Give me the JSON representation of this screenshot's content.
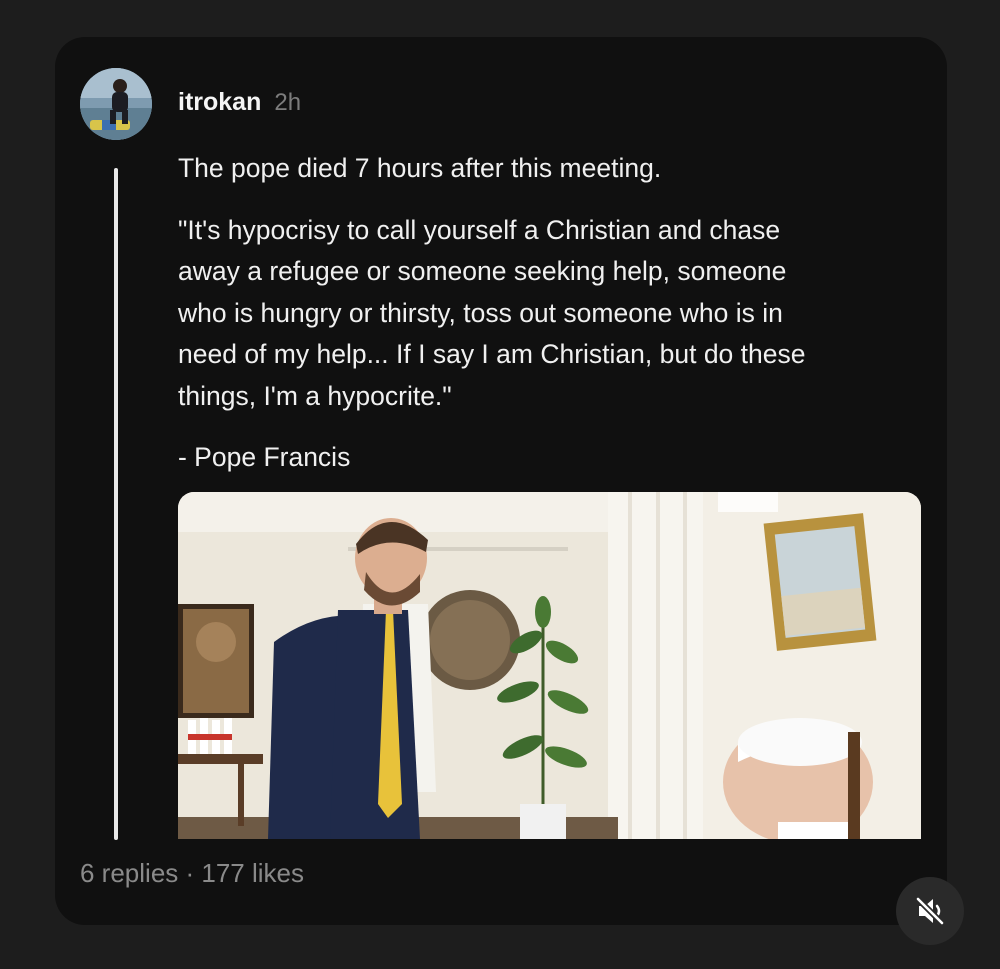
{
  "post": {
    "username": "itrokan",
    "time": "2h",
    "paragraphs": [
      "The pope died 7 hours after this meeting.",
      "\"It's hypocrisy to call yourself a Christian and chase\naway a refugee or someone seeking help, someone\nwho is hungry or thirsty, toss out someone who is in\nneed of my help... If I say I am Christian, but do these\nthings, I'm a hypocrite.\"",
      "- Pope Francis"
    ]
  },
  "footer": {
    "stats": "6 replies · 177 likes"
  },
  "icons": {
    "mute": "speaker-muted-icon"
  },
  "colors": {
    "background": "#1d1d1d",
    "card": "#101010",
    "text": "#f0f0f0",
    "muted_text": "#8a8a8a"
  }
}
